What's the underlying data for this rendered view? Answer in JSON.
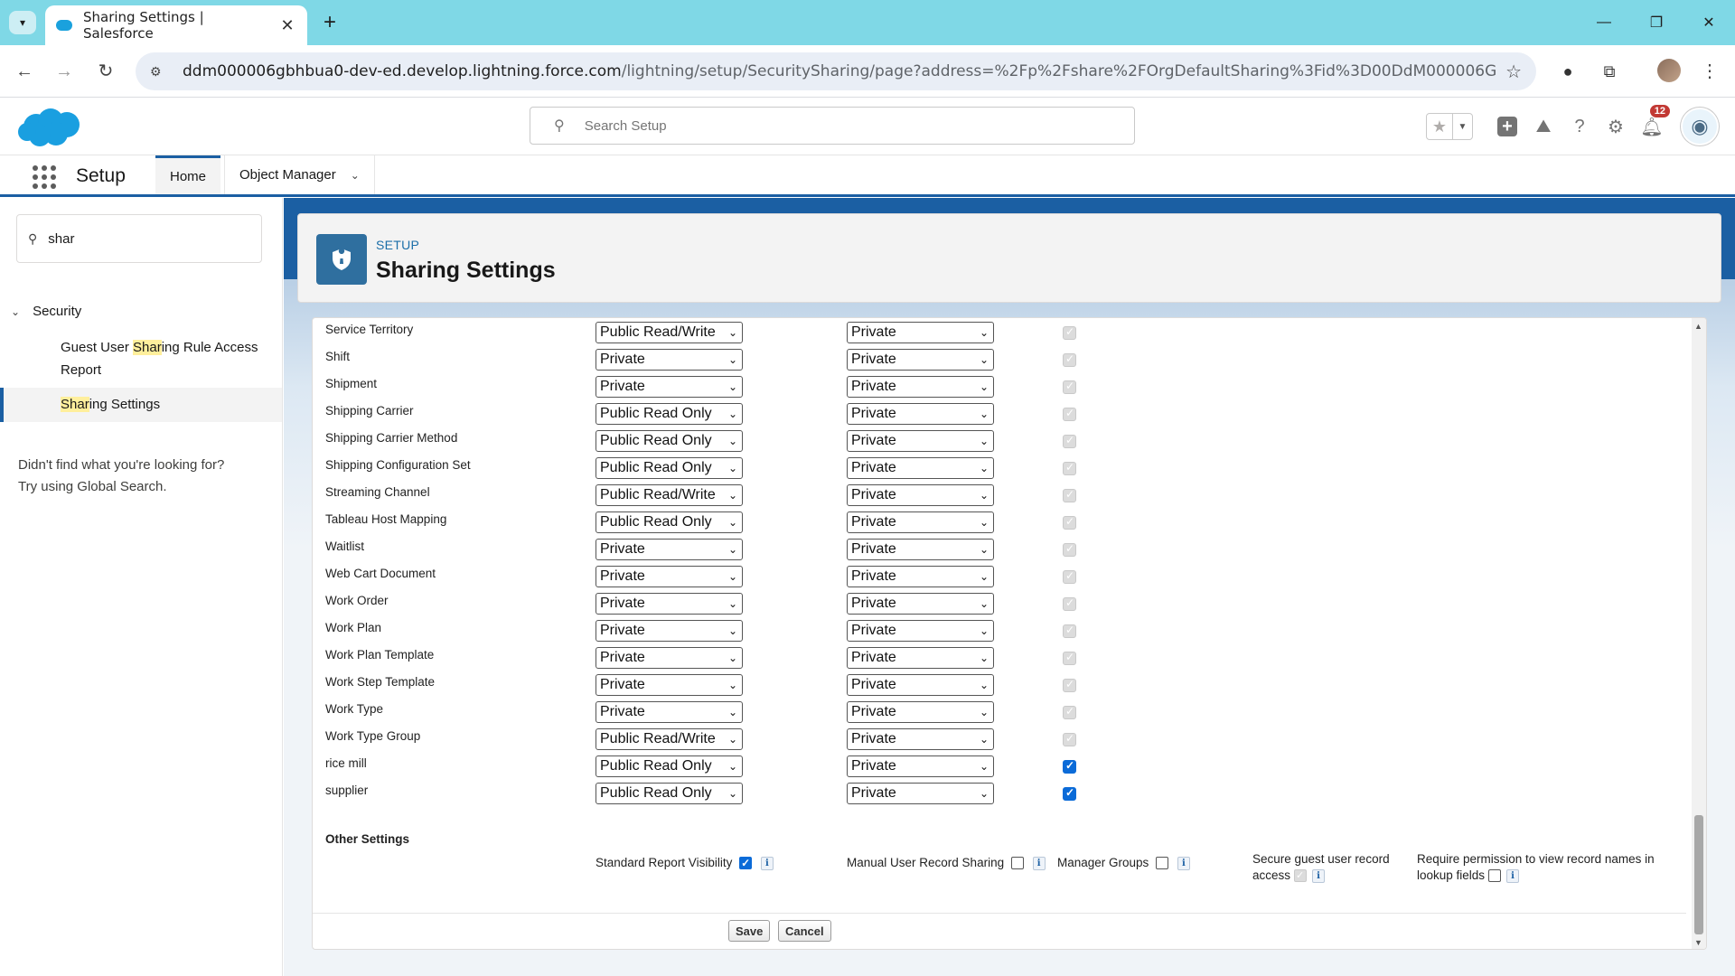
{
  "browser": {
    "tab_title": "Sharing Settings | Salesforce",
    "url_host": "ddm000006gbhbua0-dev-ed.develop.lightning.force.com",
    "url_path": "/lightning/setup/SecuritySharing/page?address=%2Fp%2Fshare%2FOrgDefaultSharing%3Fid%3D00DdM000006GbHB%26retURL..."
  },
  "header": {
    "search_placeholder": "Search Setup",
    "notification_count": "12"
  },
  "nav": {
    "app_name": "Setup",
    "tabs": [
      {
        "label": "Home"
      },
      {
        "label": "Object Manager"
      }
    ]
  },
  "sidebar": {
    "quick_find_value": "shar",
    "section": "Security",
    "items": [
      {
        "prefix": "Guest User ",
        "highlight": "Shar",
        "suffix": "ing Rule Access Report"
      },
      {
        "prefix": "",
        "highlight": "Shar",
        "suffix": "ing Settings"
      }
    ],
    "help_line1": "Didn't find what you're looking for?",
    "help_line2": "Try using Global Search."
  },
  "page": {
    "eyebrow": "SETUP",
    "title": "Sharing Settings"
  },
  "sharing_rows": [
    {
      "object": "Service Territory",
      "internal": "Public Read/Write",
      "external": "Private",
      "grant_access": "disabled"
    },
    {
      "object": "Shift",
      "internal": "Private",
      "external": "Private",
      "grant_access": "disabled"
    },
    {
      "object": "Shipment",
      "internal": "Private",
      "external": "Private",
      "grant_access": "disabled"
    },
    {
      "object": "Shipping Carrier",
      "internal": "Public Read Only",
      "external": "Private",
      "grant_access": "disabled"
    },
    {
      "object": "Shipping Carrier Method",
      "internal": "Public Read Only",
      "external": "Private",
      "grant_access": "disabled"
    },
    {
      "object": "Shipping Configuration Set",
      "internal": "Public Read Only",
      "external": "Private",
      "grant_access": "disabled"
    },
    {
      "object": "Streaming Channel",
      "internal": "Public Read/Write",
      "external": "Private",
      "grant_access": "disabled"
    },
    {
      "object": "Tableau Host Mapping",
      "internal": "Public Read Only",
      "external": "Private",
      "grant_access": "disabled"
    },
    {
      "object": "Waitlist",
      "internal": "Private",
      "external": "Private",
      "grant_access": "disabled"
    },
    {
      "object": "Web Cart Document",
      "internal": "Private",
      "external": "Private",
      "grant_access": "disabled"
    },
    {
      "object": "Work Order",
      "internal": "Private",
      "external": "Private",
      "grant_access": "disabled"
    },
    {
      "object": "Work Plan",
      "internal": "Private",
      "external": "Private",
      "grant_access": "disabled"
    },
    {
      "object": "Work Plan Template",
      "internal": "Private",
      "external": "Private",
      "grant_access": "disabled"
    },
    {
      "object": "Work Step Template",
      "internal": "Private",
      "external": "Private",
      "grant_access": "disabled"
    },
    {
      "object": "Work Type",
      "internal": "Private",
      "external": "Private",
      "grant_access": "disabled"
    },
    {
      "object": "Work Type Group",
      "internal": "Public Read/Write",
      "external": "Private",
      "grant_access": "disabled"
    },
    {
      "object": "rice mill",
      "internal": "Public Read Only",
      "external": "Private",
      "grant_access": "checked"
    },
    {
      "object": "supplier",
      "internal": "Public Read Only",
      "external": "Private",
      "grant_access": "checked"
    }
  ],
  "other_settings": {
    "title": "Other Settings",
    "standard_report_visibility": "Standard Report Visibility",
    "manual_user_record_sharing": "Manual User Record Sharing",
    "manager_groups": "Manager Groups",
    "secure_guest_line1": "Secure guest user record",
    "secure_guest_line2": "access",
    "require_permission_line1": "Require permission to view record names in",
    "require_permission_line2": "lookup fields"
  },
  "actions": {
    "save": "Save",
    "cancel": "Cancel"
  },
  "colors": {
    "brand_blue": "#1b5fa3",
    "checkbox_blue": "#0b6bd8",
    "chrome_tabbar": "#7fd8e6",
    "search_highlight": "#ffef9c"
  }
}
